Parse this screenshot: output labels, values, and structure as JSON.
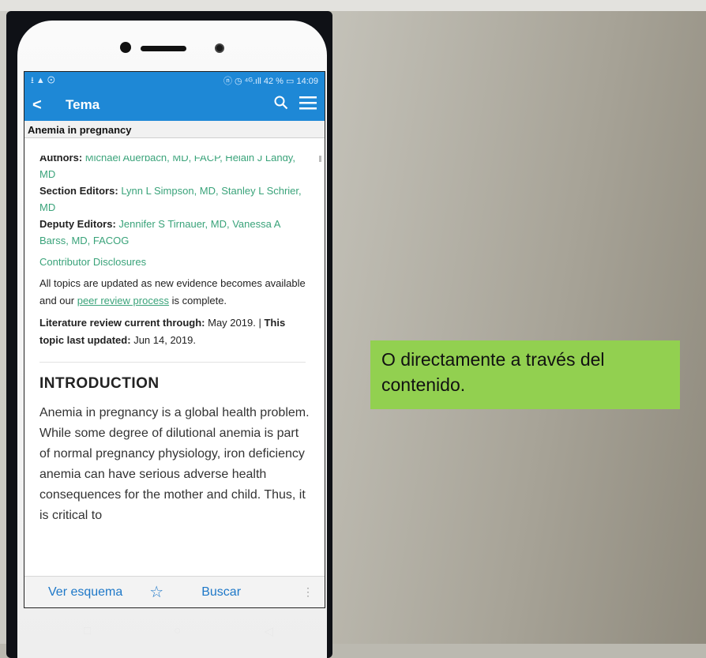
{
  "status": {
    "left_icons": "⭳ ▲ ⊙",
    "right": "ⓝ ◷ ⁴ᴳ.ıll 42 % ▭ 14:09"
  },
  "toolbar": {
    "back_icon": "<",
    "title": "Tema",
    "search_icon": "🔍",
    "menu_icon": "☰"
  },
  "topic_header": "Anemia in pregnancy",
  "authors": {
    "label": "Authors:",
    "value": "Michael Auerbach, MD, FACP, Helain J Landy, MD"
  },
  "section_editors": {
    "label": "Section Editors:",
    "value": "Lynn L Simpson, MD, Stanley L Schrier, MD"
  },
  "deputy_editors": {
    "label": "Deputy Editors:",
    "value": "Jennifer S Tirnauer, MD, Vanessa A Barss, MD, FACOG"
  },
  "disclosures": "Contributor Disclosures",
  "updated_text_1": "All topics are updated as new evidence becomes available and our",
  "peer_link": "peer review process",
  "updated_text_2": "is complete.",
  "literature": {
    "label": "Literature review current through:",
    "value": "May 2019.",
    "sep": "|",
    "label2": "This topic last updated:",
    "value2": "Jun 14, 2019."
  },
  "intro": {
    "heading": "INTRODUCTION",
    "body": "Anemia in pregnancy is a global health problem. While some degree of dilutional anemia is part of normal pregnancy physiology, iron deficiency anemia can have serious adverse health consequences for the mother and child. Thus, it is critical to"
  },
  "bottombar": {
    "outline": "Ver esquema",
    "star_icon": "☆",
    "search": "Buscar",
    "more_icon": "⋮"
  },
  "navbar": {
    "back": "◁",
    "home": "○",
    "recent": "□"
  },
  "callout": "O directamente a través del contenido.",
  "colors": {
    "accent": "#1e88d6",
    "link": "#3aa37a",
    "callout": "#92d050"
  }
}
